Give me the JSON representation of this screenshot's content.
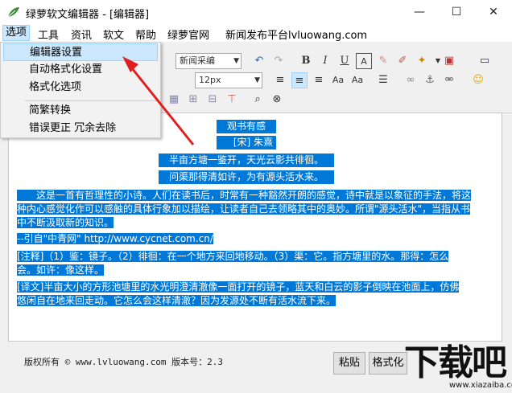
{
  "window": {
    "title": "绿萝软文编辑器 - [编辑器]",
    "minimize": "—",
    "maximize": "☐",
    "close": "✕"
  },
  "menu": {
    "items": [
      "选项",
      "工具",
      "资讯",
      "软文",
      "帮助",
      "绿萝官网",
      "新闻发布平台lvluowang.com"
    ]
  },
  "dropdown": {
    "items": [
      "编辑器设置",
      "自动格式化设置",
      "格式化选项",
      "简繁转换",
      "错误更正 冗余去除"
    ]
  },
  "toolbar": {
    "font_name": "新闻采编",
    "font_size": "12px",
    "bold": "B",
    "italic": "I",
    "underline": "U"
  },
  "editor": {
    "title": "观书有感",
    "author": "[宋] 朱熹",
    "line1": "半亩方塘一鉴开，天光云影共徘徊。",
    "line2": "问渠那得清如许，为有源头活水来。",
    "para1a": "　　这是一首有哲理性的小诗。人们在读书后，时常有一种豁然开朗的感觉，诗中就是以象征的手法，将这",
    "para1b": "种内心感觉化作可以感触的具体行象加以描绘，让读者自己去领略其中的奥妙。所谓\"源头活水\"，当指从书",
    "para1c": "中不断汲取新的知识。",
    "source": "--引自\"中青网\" http://www.cycnet.com.cn/",
    "note1": "[注释]（1）鉴：镜子。（2）徘徊：在一个地方来回地移动。（3）渠：它。指方塘里的水。那得：怎么",
    "note2": "会。如许：像这样。",
    "trans1": "[译文]半亩大小的方形池塘里的水光明澄清澈像一面打开的镜子，蓝天和白云的影子倒映在池面上，仿佛",
    "trans2": "悠闲自在地来回走动。它怎么会这样清澈？因为发源处不断有活水流下来。"
  },
  "footer": {
    "copyright": "版权所有 © www.lvluowang.com 版本号：2.3",
    "paste": "粘贴",
    "format": "格式化"
  },
  "watermark": {
    "cn": "下载吧",
    "en": "www.xiazaiba.com"
  },
  "colors": {
    "selection": "#0078d7",
    "arrow": "#e02020"
  }
}
